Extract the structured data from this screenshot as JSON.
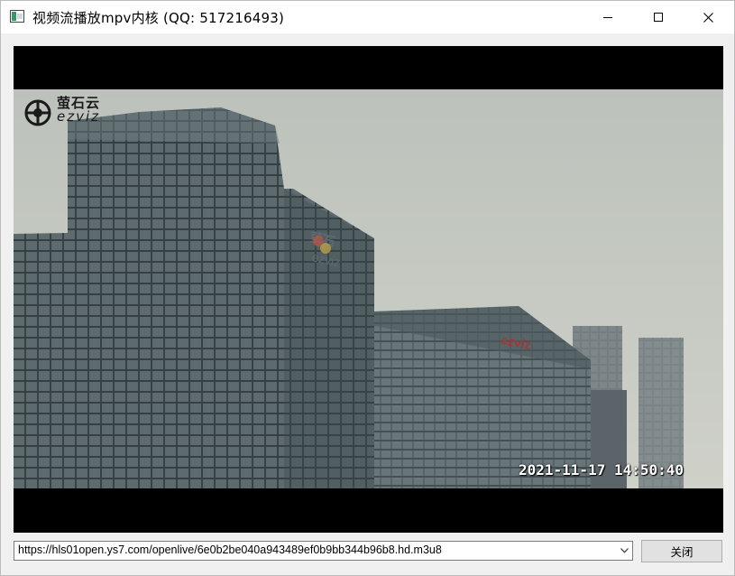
{
  "window": {
    "title": "视频流播放mpv内核 (QQ: 517216493)",
    "controls": {
      "minimize_icon": "minimize-icon",
      "maximize_icon": "maximize-icon",
      "close_icon": "close-icon"
    }
  },
  "video": {
    "watermark_brand": "萤石云",
    "watermark_sub": "ezviz",
    "timestamp": "2021-11-17 14:50:40"
  },
  "url_bar": {
    "value": "https://hls01open.ys7.com/openlive/6e0b2be040a943489ef0b9bb344b96b8.hd.m3u8",
    "dropdown_icon": "chevron-down-icon"
  },
  "buttons": {
    "close_label": "关闭"
  }
}
